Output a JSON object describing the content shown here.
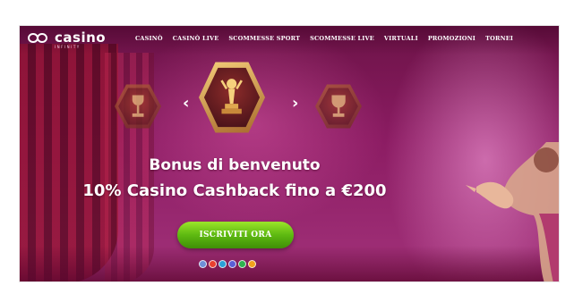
{
  "brand": {
    "logo_text": "casino",
    "logo_subtext": "INFINITY"
  },
  "nav": {
    "items": [
      "CASINÒ",
      "CASINÒ LIVE",
      "SCOMMESSE SPORT",
      "SCOMMESSE LIVE",
      "VIRTUALI",
      "PROMOZIONI",
      "TORNEI"
    ]
  },
  "carousel": {
    "prev_arrow": "‹",
    "next_arrow": "›"
  },
  "hero": {
    "headline_1": "Bonus di benvenuto",
    "headline_2": "10% Casino Cashback fino a €200",
    "cta_label": "ISCRIVITI ORA"
  },
  "payments": {
    "methods": [
      "payment-1",
      "payment-2",
      "payment-3",
      "payment-4",
      "payment-5",
      "payment-6"
    ],
    "colors": [
      "#6f8fd8",
      "#e9412f",
      "#2aa0d8",
      "#5b5fd6",
      "#2fb34f",
      "#f1a21c"
    ]
  },
  "colors": {
    "background": "#8c1c63",
    "cta_green": "#5eb911",
    "trophy_gold": "#f6d17c"
  }
}
